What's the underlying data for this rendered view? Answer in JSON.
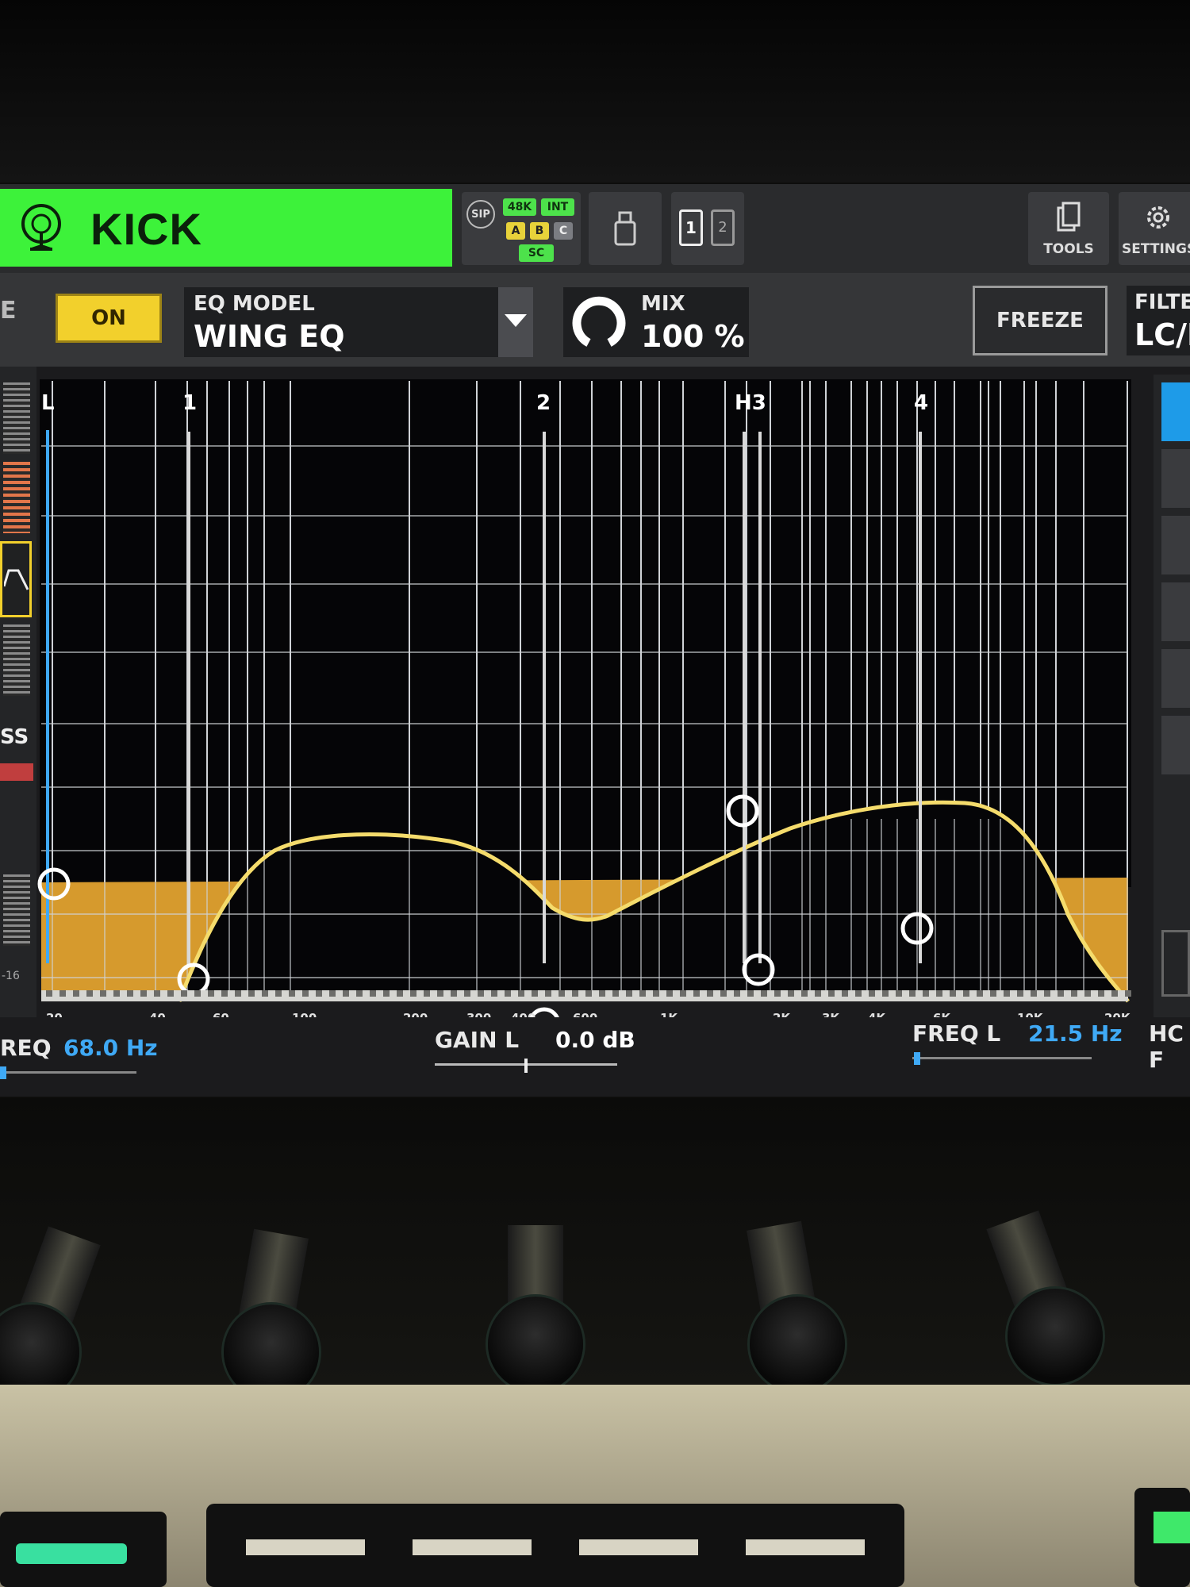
{
  "channel": {
    "name": "KICK",
    "color": "#3df23a"
  },
  "status": {
    "sip": "SIP",
    "rate": "48K",
    "clock": "INT",
    "a": "A",
    "b": "B",
    "c": "C",
    "sc": "SC"
  },
  "toolbar": {
    "tools": "TOOLS",
    "settings": "SETTINGS",
    "layer1": "1",
    "layer2": "2"
  },
  "eq": {
    "on_label": "ON",
    "model_label": "EQ MODEL",
    "model_value": "WING EQ",
    "mix_label": "MIX",
    "mix_value": "100 %",
    "freeze_label": "FREEZE",
    "filter_label": "FILTE",
    "filter_value": "LC/H"
  },
  "bands": [
    {
      "label": "L"
    },
    {
      "label": "1"
    },
    {
      "label": "2"
    },
    {
      "label": "H3"
    },
    {
      "label": "4"
    }
  ],
  "freq_axis": [
    "20",
    "40",
    "60",
    "100",
    "200",
    "300",
    "400",
    "600",
    "1K",
    "2K",
    "3K",
    "4K",
    "6K",
    "10K",
    "20K"
  ],
  "left_strip": {
    "ss": "SS",
    "scale": "-16"
  },
  "params": {
    "freq_label": "REQ",
    "freq_value": "68.0 Hz",
    "gain_label": "GAIN L",
    "gain_value": "0.0 dB",
    "freql_label": "FREQ L",
    "freql_value": "21.5 Hz",
    "hc_label": "HC F"
  },
  "colors": {
    "accent_blue": "#3fa9f5",
    "eq_fill": "#d69a2d",
    "eq_curve": "#f5dc6c",
    "on_yellow": "#f2d02c"
  }
}
